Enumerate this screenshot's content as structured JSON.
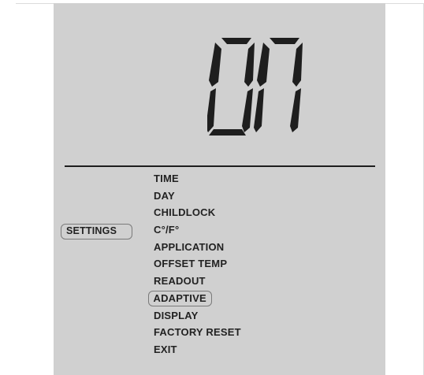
{
  "display": {
    "value": "ON"
  },
  "settings": {
    "label": "SETTINGS"
  },
  "menu": {
    "items": [
      {
        "label": "TIME",
        "selected": false
      },
      {
        "label": "DAY",
        "selected": false
      },
      {
        "label": "CHILDLOCK",
        "selected": false
      },
      {
        "label": "C°/F°",
        "selected": false
      },
      {
        "label": "APPLICATION",
        "selected": false
      },
      {
        "label": "OFFSET TEMP",
        "selected": false
      },
      {
        "label": "READOUT",
        "selected": false
      },
      {
        "label": "ADAPTIVE",
        "selected": true
      },
      {
        "label": "DISPLAY",
        "selected": false
      },
      {
        "label": "FACTORY RESET",
        "selected": false
      },
      {
        "label": "EXIT",
        "selected": false
      }
    ]
  },
  "colors": {
    "panel": "#d0d0d0",
    "segment": "#1e1e1e",
    "highlight_border": "#7a7a7a"
  }
}
